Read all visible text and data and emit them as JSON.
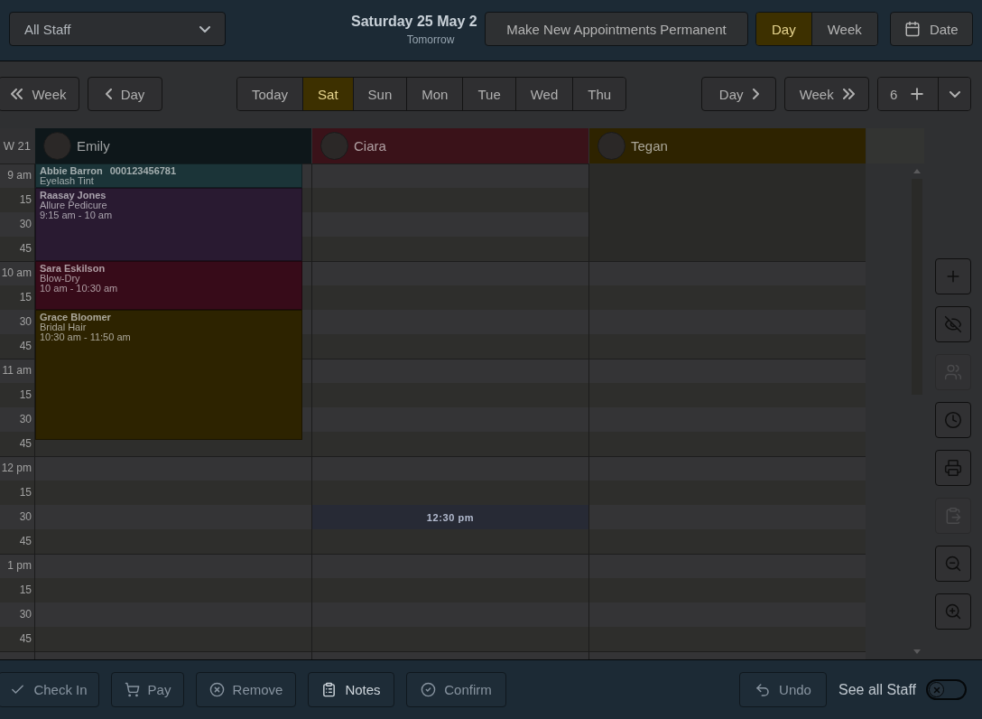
{
  "top_bar": {
    "staff_select": {
      "value": "All Staff"
    },
    "date_title": "Saturday 25 May 2",
    "date_subtitle": "Tomorrow",
    "permanent_button": "Make New Appointments Permanent",
    "view_tabs": [
      {
        "label": "Day",
        "selected": true
      },
      {
        "label": "Week",
        "selected": false
      }
    ],
    "date_button": "Date"
  },
  "nav_bar": {
    "back_buttons": [
      {
        "kind": "week",
        "label": "Week"
      },
      {
        "kind": "day",
        "label": "Day"
      }
    ],
    "day_tabs": [
      {
        "label": "Today",
        "selected": false
      },
      {
        "label": "Sat",
        "selected": true
      },
      {
        "label": "Sun",
        "selected": false
      },
      {
        "label": "Mon",
        "selected": false
      },
      {
        "label": "Tue",
        "selected": false
      },
      {
        "label": "Wed",
        "selected": false
      },
      {
        "label": "Thu",
        "selected": false
      }
    ],
    "forward_buttons": [
      {
        "kind": "day",
        "label": "Day"
      },
      {
        "kind": "week",
        "label": "Week"
      }
    ],
    "column_count": "6"
  },
  "calendar": {
    "week_label": "W 21",
    "rows": [
      {
        "label": "9 am",
        "unavailable": [
          false,
          false,
          true
        ]
      },
      {
        "label": "15",
        "unavailable": [
          false,
          false,
          true
        ]
      },
      {
        "label": "30",
        "unavailable": [
          false,
          false,
          true
        ]
      },
      {
        "label": "45",
        "unavailable": [
          false,
          false,
          true
        ]
      },
      {
        "label": "10 am",
        "unavailable": [
          false,
          false,
          false
        ]
      },
      {
        "label": "15",
        "unavailable": [
          false,
          false,
          false
        ]
      },
      {
        "label": "30",
        "unavailable": [
          false,
          false,
          false
        ]
      },
      {
        "label": "45",
        "unavailable": [
          false,
          false,
          false
        ]
      },
      {
        "label": "11 am",
        "unavailable": [
          false,
          false,
          false
        ]
      },
      {
        "label": "15",
        "unavailable": [
          false,
          false,
          false
        ]
      },
      {
        "label": "30",
        "unavailable": [
          false,
          false,
          false
        ]
      },
      {
        "label": "45",
        "unavailable": [
          false,
          false,
          false
        ]
      },
      {
        "label": "12 pm",
        "unavailable": [
          false,
          false,
          false
        ]
      },
      {
        "label": "15",
        "unavailable": [
          false,
          false,
          false
        ]
      },
      {
        "label": "30",
        "unavailable": [
          false,
          false,
          false
        ]
      },
      {
        "label": "45",
        "unavailable": [
          false,
          false,
          false
        ]
      },
      {
        "label": "1 pm",
        "unavailable": [
          false,
          false,
          false
        ]
      },
      {
        "label": "15",
        "unavailable": [
          false,
          false,
          false
        ]
      },
      {
        "label": "30",
        "unavailable": [
          false,
          false,
          false
        ]
      },
      {
        "label": "45",
        "unavailable": [
          false,
          false,
          false
        ]
      }
    ],
    "staff": [
      {
        "name": "Emily",
        "color": "#0e171a",
        "appointments": [
          {
            "client": "Abbie Barron",
            "phone": "000123456781",
            "service": "Eyelash Tint",
            "color": "#1b3438"
          },
          {
            "client": "Raasay Jones",
            "service": "Allure Pedicure",
            "time": "9:15 am - 10 am",
            "color": "#291a31"
          },
          {
            "client": "Sara Eskilson",
            "service": "Blow-Dry",
            "time": "10 am - 10:30 am",
            "color": "#370b19"
          },
          {
            "client": "Grace Bloomer",
            "service": "Bridal Hair",
            "time": "10:30 am - 11:50 am",
            "color": "#2d2300"
          }
        ]
      },
      {
        "name": "Ciara",
        "color": "#3a1219",
        "hover_slot": "12:30 pm"
      },
      {
        "name": "Tegan",
        "color": "#2e2300"
      }
    ]
  },
  "side_tools": [
    {
      "kind": "add",
      "disabled": false
    },
    {
      "kind": "hide",
      "disabled": false
    },
    {
      "kind": "group",
      "disabled": true
    },
    {
      "kind": "clock",
      "disabled": false
    },
    {
      "kind": "print",
      "disabled": false
    },
    {
      "kind": "paste",
      "disabled": true
    },
    {
      "kind": "zoom_out",
      "disabled": false
    },
    {
      "kind": "zoom_in",
      "disabled": false
    }
  ],
  "bottom_bar": {
    "actions": [
      {
        "kind": "check",
        "label": "Check In",
        "disabled": true
      },
      {
        "kind": "cart",
        "label": "Pay",
        "disabled": true
      },
      {
        "kind": "remove",
        "label": "Remove",
        "disabled": true
      },
      {
        "kind": "notes",
        "label": "Notes",
        "disabled": false
      },
      {
        "kind": "confirm",
        "label": "Confirm",
        "disabled": true
      }
    ],
    "undo": {
      "label": "Undo",
      "disabled": true
    },
    "see_all_staff": {
      "label": "See all Staff",
      "on": false
    }
  }
}
